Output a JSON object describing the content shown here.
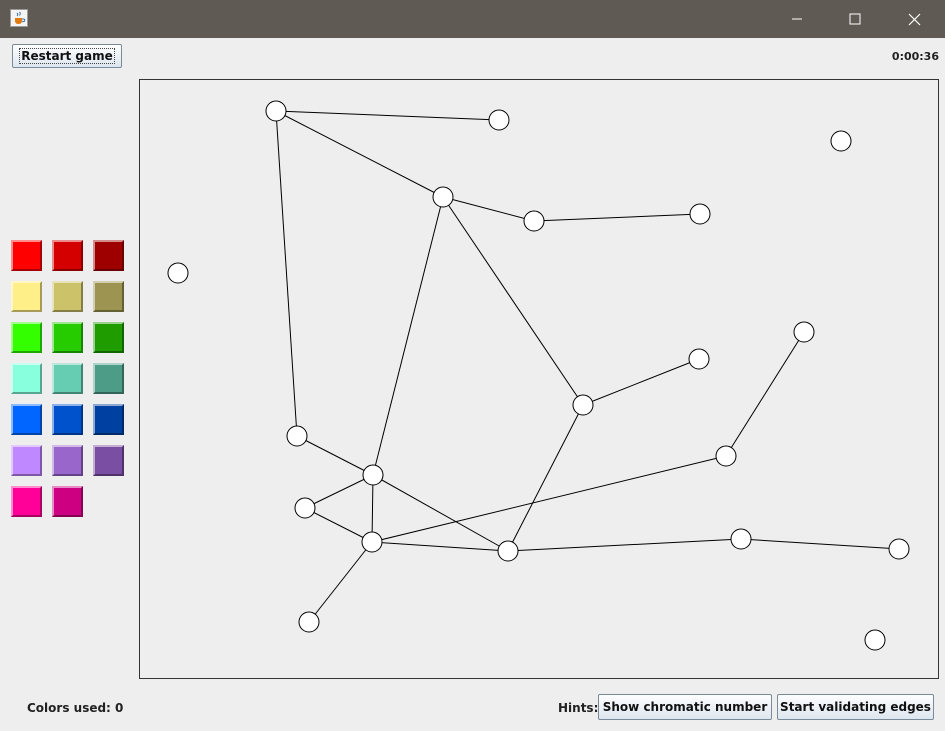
{
  "window": {
    "app_icon": "java-cup-icon",
    "minimize_icon": "minimize-icon",
    "maximize_icon": "maximize-icon",
    "close_icon": "close-icon"
  },
  "toolbar": {
    "restart_label": "Restart game",
    "timer": "0:00:36"
  },
  "palette": {
    "rows": [
      [
        "#ff0000",
        "#d40000",
        "#9e0000"
      ],
      [
        "#ffef88",
        "#ccc26a",
        "#9c9450"
      ],
      [
        "#33ff00",
        "#26cc00",
        "#1e9c00"
      ],
      [
        "#88ffdd",
        "#66ccb2",
        "#4d9c88"
      ],
      [
        "#0066ff",
        "#0052cc",
        "#0040a0"
      ],
      [
        "#c088ff",
        "#9966cc",
        "#7a4ea2"
      ],
      [
        "#ff0099",
        "#cc0080"
      ]
    ]
  },
  "graph": {
    "vertex_count": 20,
    "edge_count": 19,
    "vertex_fill": "#ffffff",
    "edge_color": "#000000"
  },
  "footer": {
    "colors_used_label": "Colors used: 0",
    "hints_label": "Hints:",
    "chromatic_button": "Show chromatic number",
    "validate_button": "Start validating edges"
  }
}
